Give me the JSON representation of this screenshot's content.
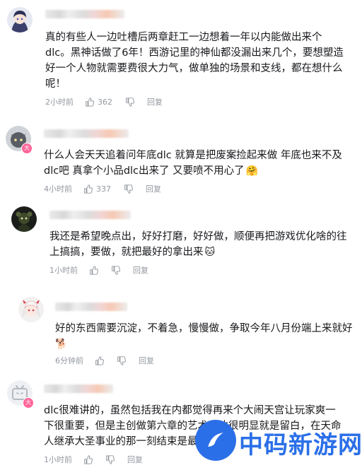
{
  "comments": [
    {
      "lines": [
        "真的有些人一边吐槽后两章赶工一边想着一年以内能做出来个",
        "dlc。黑神话做了6年！西游记里的神仙都没漏出来几个，要想塑造",
        "好一个人物就需要费很大力气，做单独的场景和支线，都在想什么",
        "呢！"
      ],
      "time": "2小时前",
      "likes": "362",
      "reply": "回复",
      "emoji": ""
    },
    {
      "lines": [
        "什么人会天天追着问年底dlc 就算是把废案捡起来做 年底也来不及",
        "dlc吧 真拿个小品dlc出来了 又要喷不用心了"
      ],
      "time": "4小时前",
      "likes": "337",
      "reply": "回复",
      "emoji": "🤗"
    },
    {
      "lines": [
        "我还是希望晚点出，好好打磨，好好做，顺便再把游戏优化啥的往",
        "上搞搞，要做，就把最好的拿出来"
      ],
      "time": "1小时前",
      "likes": "",
      "reply": "回复",
      "emoji": "🐱"
    },
    {
      "lines": [
        "好的东西需要沉淀，不着急，慢慢做，争取今年八月份端上来就好"
      ],
      "time": "6分钟前",
      "likes": "",
      "reply": "回复",
      "emoji": "🐕"
    },
    {
      "lines": [
        "dlc很难讲的，虽然包括我在内都觉得再来个大闹天宫让玩家爽一",
        "下很重要，但是主创做第六章的艺术表达很明显就是留白，在天命",
        "人继承大圣事业的那一刻结束是最"
      ],
      "time": "1小时前",
      "likes": "",
      "reply": "回复",
      "emoji": ""
    }
  ],
  "watermark": {
    "text": "中码新游网"
  },
  "colors": {
    "meta": "#9499a0",
    "badge": "#ff6699",
    "watermark": "#2b6fe8"
  }
}
